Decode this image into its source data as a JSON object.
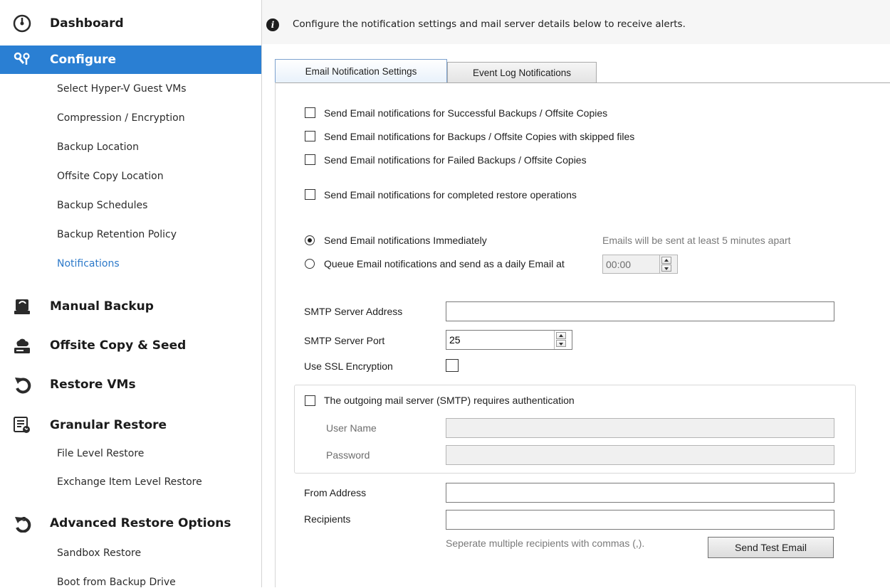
{
  "sidebar": {
    "sections": [
      {
        "label": "Dashboard",
        "icon": "dashboard-gauge-icon"
      },
      {
        "label": "Configure",
        "icon": "configure-tools-icon",
        "active": true
      },
      {
        "label": "Manual Backup",
        "icon": "manual-backup-drive-icon"
      },
      {
        "label": "Offsite Copy & Seed",
        "icon": "offsite-copy-cloud-drive-icon"
      },
      {
        "label": "Restore VMs",
        "icon": "restore-arrow-icon"
      },
      {
        "label": "Granular Restore",
        "icon": "granular-restore-list-icon"
      },
      {
        "label": "Advanced Restore Options",
        "icon": "advanced-restore-icon"
      }
    ],
    "configure_items": [
      "Select Hyper-V Guest VMs",
      "Compression / Encryption",
      "Backup Location",
      "Offsite Copy Location",
      "Backup Schedules",
      "Backup Retention Policy",
      "Notifications"
    ],
    "granular_items": [
      "File Level Restore",
      "Exchange Item Level Restore"
    ],
    "advanced_items": [
      "Sandbox Restore",
      "Boot from Backup Drive"
    ],
    "active_item": "Notifications",
    "accent_color": "#2a7fd3"
  },
  "info": {
    "icon": "info-icon",
    "text": "Configure the notification settings and mail server details below to receive alerts."
  },
  "tabs": [
    {
      "label": "Email Notification Settings",
      "selected": true
    },
    {
      "label": "Event Log Notifications",
      "selected": false
    }
  ],
  "notifications": {
    "success": {
      "label": "Send Email notifications for Successful Backups / Offsite Copies",
      "checked": false
    },
    "skipped": {
      "label": "Send Email notifications for Backups / Offsite Copies with skipped files",
      "checked": false
    },
    "failed": {
      "label": "Send Email notifications for Failed Backups / Offsite Copies",
      "checked": false
    },
    "restore": {
      "label": "Send Email notifications for completed restore operations",
      "checked": false
    }
  },
  "schedule": {
    "immediate_label": "Send Email notifications Immediately",
    "immediate_hint": "Emails will be sent at least 5 minutes apart",
    "queue_label": "Queue Email notifications and send as a daily Email at",
    "time": "00:00",
    "selected": "immediate"
  },
  "smtp": {
    "address_label": "SMTP Server Address",
    "address_value": "",
    "port_label": "SMTP Server Port",
    "port_value": "25",
    "ssl_label": "Use SSL Encryption",
    "ssl_checked": false
  },
  "auth": {
    "label": "The outgoing mail server (SMTP) requires authentication",
    "checked": false,
    "user_label": "User Name",
    "user_value": "",
    "password_label": "Password",
    "password_value": ""
  },
  "email": {
    "from_label": "From Address",
    "from_value": "",
    "recipients_label": "Recipients",
    "recipients_value": "",
    "recipients_hint": "Seperate multiple recipients with commas (,).",
    "test_button": "Send Test Email"
  }
}
